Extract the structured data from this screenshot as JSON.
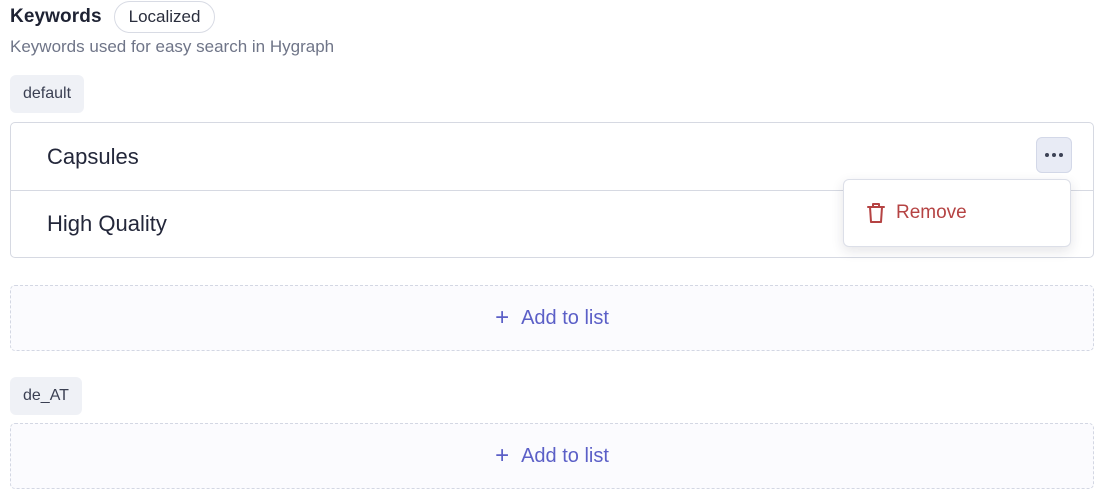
{
  "field": {
    "label": "Keywords",
    "badge": "Localized",
    "description": "Keywords used for easy search in Hygraph"
  },
  "locales": [
    {
      "code": "default",
      "items": [
        "Capsules",
        "High Quality"
      ],
      "add_label": "Add to list"
    },
    {
      "code": "de_AT",
      "items": [],
      "add_label": "Add to list"
    }
  ],
  "menu": {
    "remove_label": "Remove"
  },
  "icons": {
    "row_menu": "more-horizontal-icon",
    "remove": "trash-icon",
    "add": "plus-icon"
  },
  "colors": {
    "accent": "#5b5fc7",
    "danger": "#b54343",
    "chip_bg": "#eff1f6",
    "border": "#d6d9e2"
  }
}
